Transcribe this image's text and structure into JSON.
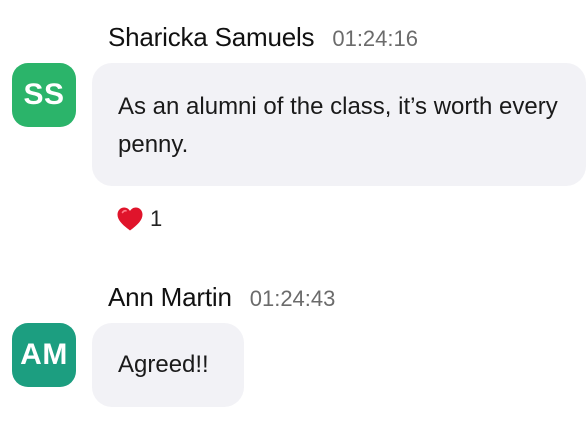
{
  "messages": [
    {
      "sender": "Sharicka Samuels",
      "time": "01:24:16",
      "avatar_initials": "SS",
      "avatar_color": "#2bb46a",
      "text": "As an alumni of the class, it’s worth every penny.",
      "reactions": [
        {
          "icon": "heart-icon",
          "count": "1"
        }
      ]
    },
    {
      "sender": "Ann Martin",
      "time": "01:24:43",
      "avatar_initials": "AM",
      "avatar_color": "#1c9e80",
      "text": "Agreed!!"
    }
  ]
}
